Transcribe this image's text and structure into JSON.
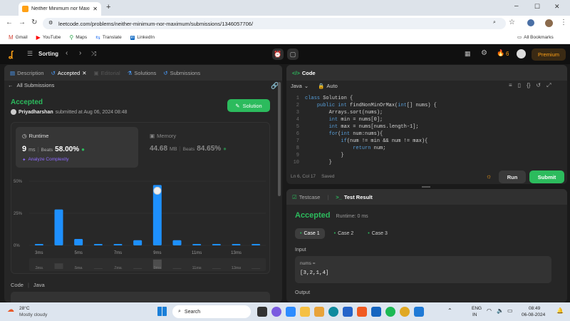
{
  "browser": {
    "tab_title": "Neither Minimum nor Maximum",
    "url": "leetcode.com/problems/neither-minimum-nor-maximum/submissions/1346057706/",
    "bookmarks": [
      "Gmail",
      "YouTube",
      "Maps",
      "Translate",
      "LinkedIn"
    ],
    "all_bookmarks": "All Bookmarks"
  },
  "header": {
    "problem_list": "Sorting",
    "streak": "6",
    "premium": "Premium"
  },
  "left_tabs": [
    "Description",
    "Accepted",
    "Editorial",
    "Solutions",
    "Submissions"
  ],
  "submission": {
    "back_label": "All Submissions",
    "status": "Accepted",
    "user": "Priyadharshan",
    "submitted_text": "submitted at Aug 06, 2024 08:48",
    "solution_button": "Solution",
    "runtime_label": "Runtime",
    "runtime_value": "9",
    "runtime_unit": "ms",
    "runtime_beats_label": "Beats",
    "runtime_beats": "58.00%",
    "analyze": "Analyze Complexity",
    "memory_label": "Memory",
    "memory_value": "44.68",
    "memory_unit": "MB",
    "memory_beats_label": "Beats",
    "memory_beats": "84.65%",
    "code_label": "Code",
    "code_lang": "Java"
  },
  "chart_data": {
    "type": "bar",
    "y_ticks": [
      "50%",
      "25%",
      "0%"
    ],
    "x_tick_labels": [
      "3ms",
      "5ms",
      "7ms",
      "9ms",
      "11ms",
      "13ms"
    ],
    "ylim": [
      0,
      50
    ],
    "values": [
      1,
      28,
      5,
      1,
      1,
      4,
      47,
      4,
      1,
      1,
      1,
      1
    ],
    "highlight_index": 6
  },
  "editor": {
    "title": "Code",
    "language": "Java",
    "mode": "Auto",
    "lines": [
      "class Solution {",
      "    public int findNonMinOrMax(int[] nums) {",
      "        Arrays.sort(nums);",
      "        int min = nums[0];",
      "        int max = nums[nums.length-1];",
      "        for(int num:nums){",
      "            if(num != min && num != max){",
      "                return num;",
      "            }",
      "        }"
    ],
    "status": "Ln 6, Col 17",
    "saved": "Saved",
    "run": "Run",
    "submit": "Submit"
  },
  "console": {
    "tab_testcase": "Testcase",
    "tab_result": "Test Result",
    "status": "Accepted",
    "runtime": "Runtime: 0 ms",
    "cases": [
      "Case 1",
      "Case 2",
      "Case 3"
    ],
    "input_label": "Input",
    "var_name": "nums =",
    "var_value": "[3,2,1,4]",
    "output_label": "Output"
  },
  "taskbar": {
    "temp": "28°C",
    "weather": "Mostly cloudy",
    "search": "Search",
    "lang1": "ENG",
    "lang2": "IN",
    "time": "08:49",
    "date": "06-08-2024"
  }
}
